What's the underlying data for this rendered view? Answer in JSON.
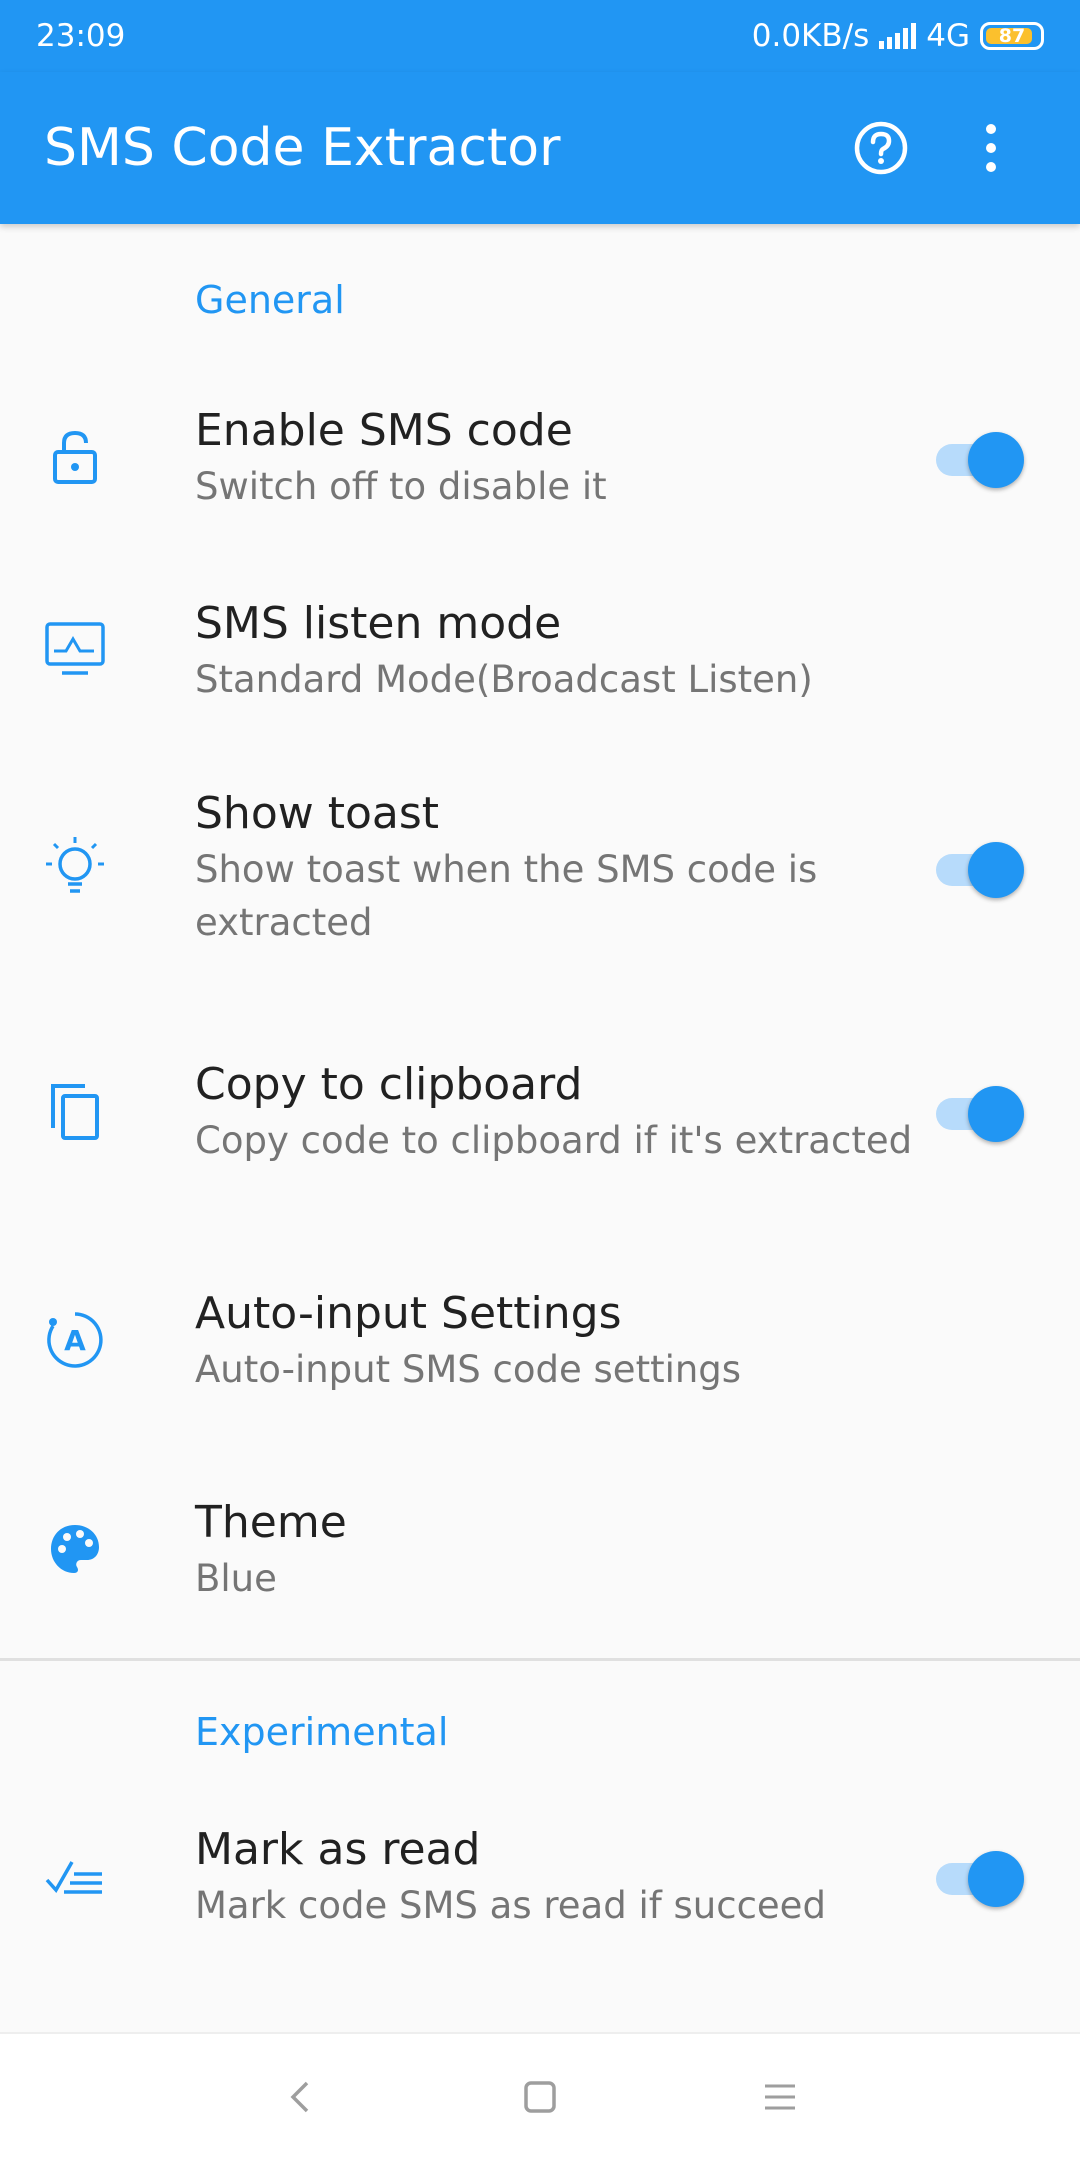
{
  "status_bar": {
    "time": "23:09",
    "net_speed": "0.0KB/s",
    "network_type": "4G",
    "battery": "87"
  },
  "app_bar": {
    "title": "SMS Code Extractor",
    "help_icon": "help-circle-icon",
    "menu_icon": "more-vert-icon"
  },
  "sections": {
    "general": "General",
    "experimental": "Experimental"
  },
  "prefs": [
    {
      "title": "Enable SMS code",
      "summary": "Switch off to disable it",
      "icon": "lock-open-icon",
      "toggle": true
    },
    {
      "title": "SMS listen mode",
      "summary": "Standard Mode(Broadcast Listen)",
      "icon": "monitor-icon",
      "toggle": null
    },
    {
      "title": "Show toast",
      "summary": "Show toast when the SMS code is extracted",
      "icon": "lightbulb-icon",
      "toggle": true
    },
    {
      "title": "Copy to clipboard",
      "summary": "Copy code to clipboard if it's extracted",
      "icon": "copy-icon",
      "toggle": true
    },
    {
      "title": "Auto-input Settings",
      "summary": "Auto-input SMS code settings",
      "icon": "auto-input-icon",
      "toggle": null
    },
    {
      "title": "Theme",
      "summary": "Blue",
      "icon": "palette-icon",
      "toggle": null
    },
    {
      "title": "Mark as read",
      "summary": "Mark code SMS as read if succeed",
      "icon": "mark-read-icon",
      "toggle": true
    }
  ],
  "colors": {
    "primary": "#2196f3",
    "toggle_track": "#b7dbfb",
    "summary_text": "#757575"
  },
  "nav_bar": {
    "back_icon": "back-icon",
    "home_icon": "home-icon",
    "recents_icon": "recents-icon"
  }
}
